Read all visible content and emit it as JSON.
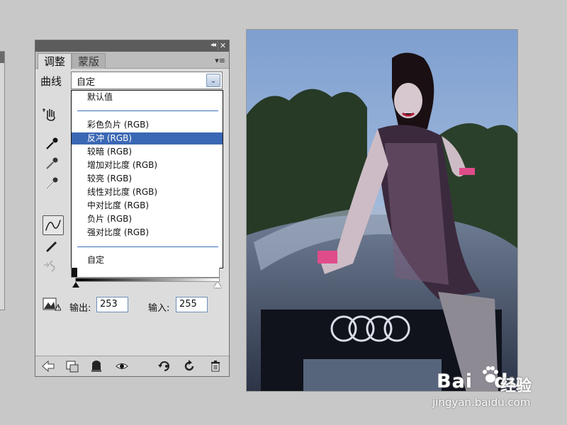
{
  "panel": {
    "tabs": [
      "调整",
      "蒙版"
    ],
    "collapse_glyph": "◂◂",
    "close_glyph": "✕",
    "menu_glyph": "▾≡"
  },
  "curves": {
    "label": "曲线",
    "preset_value": "自定",
    "preset_arrow": "⌄"
  },
  "dropdown": {
    "default_item": "默认值",
    "items": [
      "彩色负片 (RGB)",
      "反冲 (RGB)",
      "较暗 (RGB)",
      "增加对比度 (RGB)",
      "较亮 (RGB)",
      "线性对比度 (RGB)",
      "中对比度 (RGB)",
      "负片 (RGB)",
      "强对比度 (RGB)"
    ],
    "selected_index": 1,
    "custom_item": "自定"
  },
  "levels": {
    "output_label": "输出:",
    "output_value": "253",
    "input_label": "输入:",
    "input_value": "255"
  },
  "icons": {
    "tools": [
      "hand-adjust-icon",
      "eyedropper-black-icon",
      "eyedropper-gray-icon",
      "eyedropper-white-icon",
      "curve-tool-icon",
      "pencil-icon",
      "smooth-icon"
    ],
    "bottom": [
      "back-arrow-icon",
      "clip-layer-icon",
      "visibility-stamp-icon",
      "eye-icon",
      "previous-state-icon",
      "reset-icon",
      "trash-icon"
    ]
  },
  "watermark": {
    "logo_text": "Bai",
    "logo_du": "du",
    "cn_text": "经验",
    "url": "jingyan.baidu.com"
  },
  "colors": {
    "selection": "#3b68b4",
    "separator": "#3e70bb",
    "panel_bg": "#dcdcdc",
    "canvas_bg": "#c8c8c8"
  }
}
